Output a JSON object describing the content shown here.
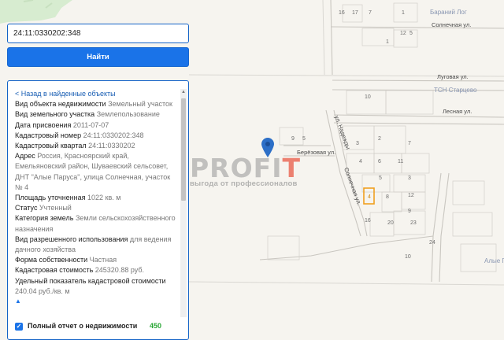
{
  "search": {
    "value": "24:11:0330202:348",
    "button_label": "Найти"
  },
  "panel": {
    "back_link": "< Назад в найденные объекты",
    "rows": [
      {
        "label": "Вид объекта недвижимости",
        "value": "Земельный участок"
      },
      {
        "label": "Вид земельного участка",
        "value": "Землепользование"
      },
      {
        "label": "Дата присвоения",
        "value": "2011-07-07"
      },
      {
        "label": "Кадастровый номер",
        "value": "24:11:0330202:348"
      },
      {
        "label": "Кадастровый квартал",
        "value": "24:11:0330202"
      },
      {
        "label": "Адрес",
        "value": "Россия, Красноярский край, Емельяновский район, Шуваевский сельсовет, ДНТ \"Алые Паруса\", улица Солнечная, участок № 4"
      },
      {
        "label": "Площадь уточненная",
        "value": "1022 кв. м"
      },
      {
        "label": "Статус",
        "value": "Учтенный"
      },
      {
        "label": "Категория земель",
        "value": "Земли сельскохозяйственного назначения"
      },
      {
        "label": "Вид разрешенного использования",
        "value": "для ведения дачного хозяйства"
      },
      {
        "label": "Форма собственности",
        "value": "Частная"
      },
      {
        "label": "Кадастровая стоимость",
        "value": "245320.88 руб."
      },
      {
        "label": "Удельный показатель кадастровой стоимости",
        "value": "240.04 руб./кв. м"
      }
    ],
    "expand_icon": "▲",
    "report_label": "Полный отчет о недвижимости",
    "report_price": "450",
    "checkbox_checked": true
  },
  "map": {
    "streets": {
      "solnechnaya_top": "Солнечная ул.",
      "lugovaya": "Луговая ул.",
      "lesnaya": "Лесная ул.",
      "berezovaya": "Берёзовая ул.",
      "nadezhdy": "ул. Надежды",
      "solnechnaya_diag": "Солнечная ул."
    },
    "places": {
      "baraniy_log": "Бараний Лог",
      "tsn_startsevo": "ТСН Старцево",
      "alye": "Алые Г"
    },
    "parcel_numbers": [
      "16",
      "17",
      "7",
      "1",
      "12",
      "1",
      "5",
      "10",
      "9",
      "5",
      "3",
      "2",
      "7",
      "4",
      "6",
      "11",
      "5",
      "3",
      "4",
      "8",
      "12",
      "20",
      "16",
      "23",
      "9",
      "24",
      "10"
    ],
    "highlight_color": "#f0a020",
    "pin_color": "#2d6fc7"
  },
  "watermark": {
    "logo_main": "PROFI",
    "logo_accent": "T",
    "tagline": "выгода от профессионалов"
  }
}
